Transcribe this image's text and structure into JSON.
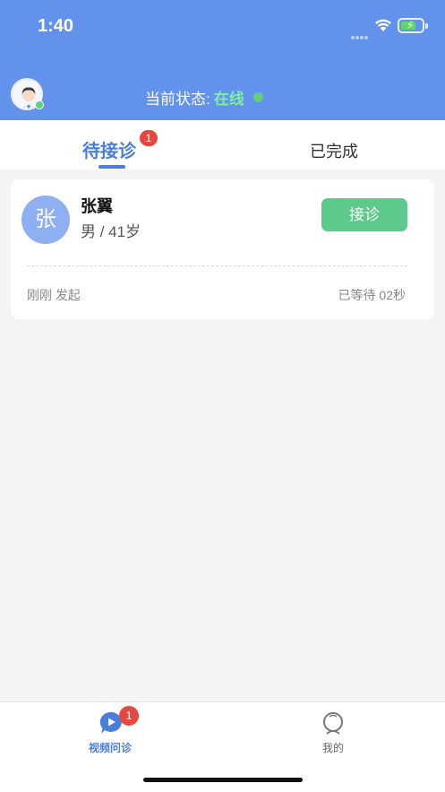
{
  "status_bar": {
    "time": "1:40"
  },
  "header": {
    "status_label": "当前状态:",
    "status_value": "在线",
    "status_color": "#5ed27a"
  },
  "tabs": [
    {
      "label": "待接诊",
      "badge": "1",
      "active": true
    },
    {
      "label": "已完成",
      "active": false
    }
  ],
  "consultation": {
    "avatar_char": "张",
    "name": "张翼",
    "info": "男 / 41岁",
    "accept_label": "接诊",
    "initiated": "刚刚 发起",
    "waited": "已等待 02秒"
  },
  "bottom_nav": [
    {
      "label": "视频问诊",
      "icon": "video-chat-icon",
      "badge": "1",
      "active": true
    },
    {
      "label": "我的",
      "icon": "user-profile-icon",
      "active": false
    }
  ],
  "colors": {
    "primary": "#6292ec",
    "accent": "#4a7edb",
    "accept": "#5dc98a",
    "badge": "#e5483f"
  }
}
